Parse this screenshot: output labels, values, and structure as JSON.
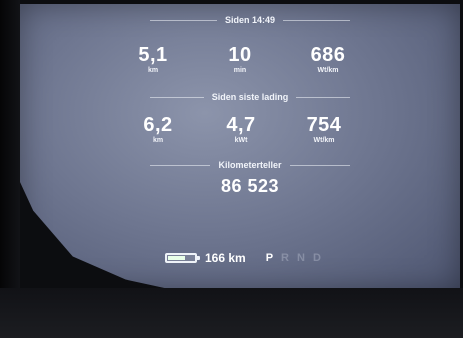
{
  "trip_since_time": {
    "title": "Siden 14:49",
    "stats": [
      {
        "value": "5,1",
        "unit": "km"
      },
      {
        "value": "10",
        "unit": "min"
      },
      {
        "value": "686",
        "unit": "Wt/km"
      }
    ]
  },
  "trip_since_charge": {
    "title": "Siden siste lading",
    "stats": [
      {
        "value": "6,2",
        "unit": "km"
      },
      {
        "value": "4,7",
        "unit": "kWt"
      },
      {
        "value": "754",
        "unit": "Wt/km"
      }
    ]
  },
  "odometer": {
    "title": "Kilometerteller",
    "value": "86 523"
  },
  "status_bar": {
    "battery_level": 0.65,
    "range": "166 km",
    "gears": [
      "P",
      "R",
      "N",
      "D"
    ],
    "active_gear": "P"
  },
  "colors": {
    "screen": "#7a8299",
    "text": "#ffffff"
  }
}
